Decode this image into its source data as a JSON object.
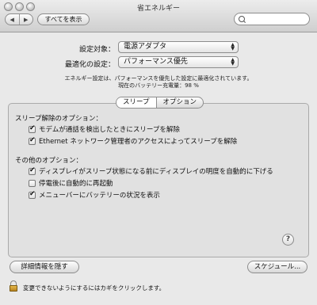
{
  "window": {
    "title": "省エネルギー"
  },
  "toolbar": {
    "back": "◀",
    "forward": "▶",
    "show_all": "すべてを表示",
    "search_placeholder": ""
  },
  "settings": {
    "target_label": "設定対象：",
    "target_value": "電源アダプタ",
    "optimize_label": "最適化の設定：",
    "optimize_value": "パフォーマンス優先",
    "info_line1": "エネルギー設定は、パフォーマンスを優先した設定に最適化されています。",
    "info_line2": "現在のバッテリー充電量：98 %"
  },
  "tabs": [
    {
      "label": "スリープ",
      "selected": true
    },
    {
      "label": "オプション",
      "selected": false
    }
  ],
  "wake": {
    "title": "スリープ解除のオプション：",
    "items": [
      {
        "label": "モデムが通話を検出したときにスリープを解除",
        "checked": true
      },
      {
        "label": "Ethernet ネットワーク管理者のアクセスによってスリープを解除",
        "checked": true
      }
    ]
  },
  "other": {
    "title": "その他のオプション：",
    "items": [
      {
        "label": "ディスプレイがスリープ状態になる前にディスプレイの明度を自動的に下げる",
        "checked": true
      },
      {
        "label": "停電後に自動的に再起動",
        "checked": false
      },
      {
        "label": "メニューバーにバッテリーの状況を表示",
        "checked": true
      }
    ]
  },
  "help_label": "?",
  "buttons": {
    "hide_details": "詳細情報を隠す",
    "schedule": "スケジュール..."
  },
  "lock_text": "変更できないようにするにはカギをクリックします。"
}
